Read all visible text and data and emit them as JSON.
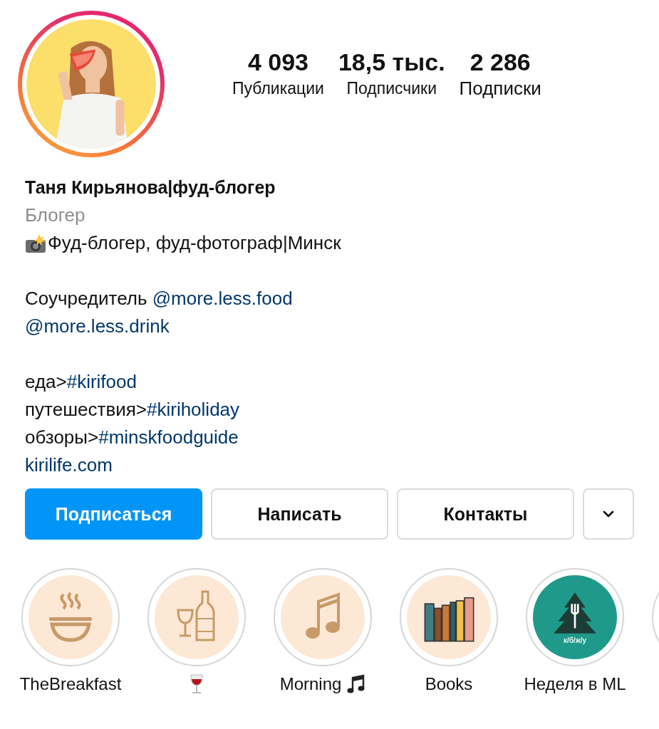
{
  "profile": {
    "stats": [
      {
        "value": "4 093",
        "label": "Публикации"
      },
      {
        "value": "18,5 тыс.",
        "label": "Подписчики"
      },
      {
        "value": "2 286",
        "label": "Подписки"
      }
    ],
    "name": "Таня Кирьянова|фуд-блогер",
    "category": "Блогер"
  },
  "bio": [
    [
      [
        {
          "text": "Фуд-блогер, фуд-фотограф|Минск",
          "link": false
        }
      ]
    ],
    [
      [
        {
          "text": "Соучредитель ",
          "link": false
        },
        {
          "text": "@more.less.food",
          "link": true
        }
      ],
      [
        {
          "text": "@more.less.drink",
          "link": true
        }
      ]
    ],
    [
      [
        {
          "text": "еда>",
          "link": false
        },
        {
          "text": "#kirifood",
          "link": true
        }
      ],
      [
        {
          "text": "путешествия>",
          "link": false
        },
        {
          "text": "#kiriholiday",
          "link": true
        }
      ],
      [
        {
          "text": "обзоры>",
          "link": false
        },
        {
          "text": "#minskfoodguide",
          "link": true
        }
      ],
      [
        {
          "text": "kirilife.com",
          "link": true
        }
      ]
    ]
  ],
  "buttons": [
    {
      "label": "Подписаться",
      "primary": true
    },
    {
      "label": "Написать",
      "primary": false
    },
    {
      "label": "Контакты",
      "primary": false
    }
  ],
  "highlights": [
    {
      "kind": "text",
      "label": "TheBreakfast"
    },
    {
      "kind": "icon"
    },
    {
      "kind": "text-icon",
      "label": "Morning"
    },
    {
      "kind": "text",
      "label": "Books"
    },
    {
      "kind": "text",
      "label": "Неделя в ML",
      "cover_text": "к/б/ж/у"
    }
  ]
}
